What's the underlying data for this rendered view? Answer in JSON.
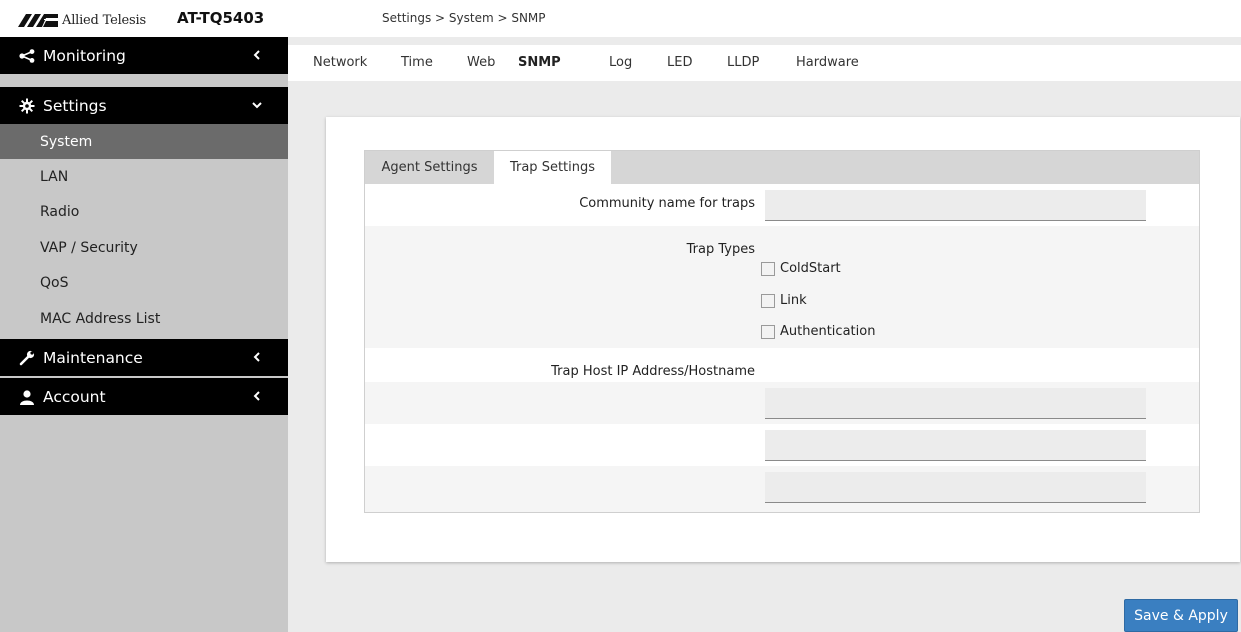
{
  "header": {
    "brand": "Allied Telesis",
    "model": "AT-TQ5403",
    "breadcrumb": "Settings > System > SNMP"
  },
  "sidebar": {
    "monitoring": "Monitoring",
    "settings": "Settings",
    "settings_items": [
      "System",
      "LAN",
      "Radio",
      "VAP / Security",
      "QoS",
      "MAC Address List"
    ],
    "active_item": "System",
    "maintenance": "Maintenance",
    "account": "Account"
  },
  "tabs": [
    "Network",
    "Time",
    "Web",
    "SNMP",
    "Log",
    "LED",
    "LLDP",
    "Hardware"
  ],
  "active_tab": "SNMP",
  "subtabs": [
    "Agent Settings",
    "Trap Settings"
  ],
  "active_subtab": "Trap Settings",
  "form": {
    "community_label": "Community name for traps",
    "community_value": "",
    "trap_types_label": "Trap Types",
    "trap_types": [
      {
        "label": "ColdStart",
        "checked": false
      },
      {
        "label": "Link",
        "checked": false
      },
      {
        "label": "Authentication",
        "checked": false
      }
    ],
    "trap_host_label": "Trap Host IP Address/Hostname",
    "trap_hosts": [
      "",
      "",
      ""
    ]
  },
  "save_label": "Save & Apply",
  "colors": {
    "sidebar_bg": "#c8c8c8",
    "nav_head_bg": "#000000",
    "active_item_bg": "#6b6b6b",
    "button": "#3a7fc1"
  },
  "icons": {
    "monitoring": "share-icon",
    "settings": "gear-icon",
    "maintenance": "wrench-icon",
    "account": "user-icon"
  }
}
